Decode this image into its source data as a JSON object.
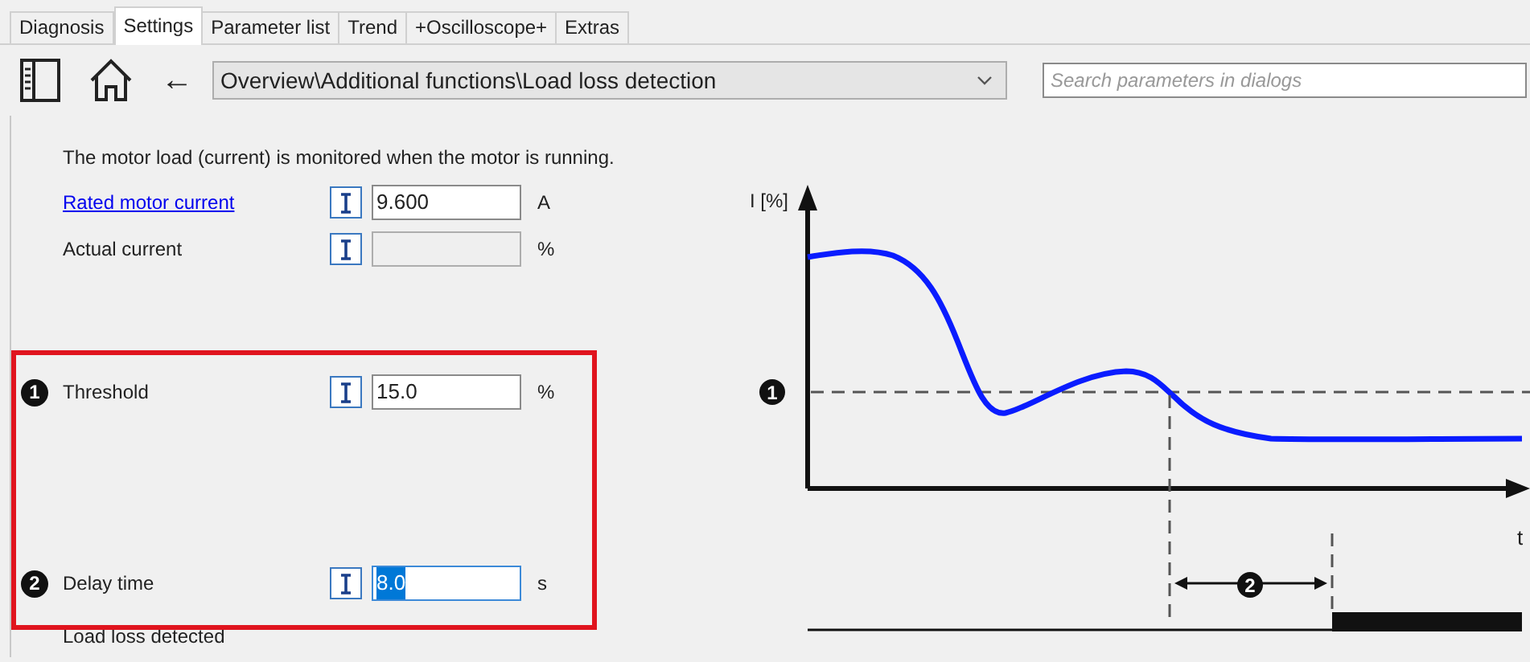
{
  "tabs": [
    {
      "label": "Diagnosis",
      "selected": false
    },
    {
      "label": "Settings",
      "selected": true
    },
    {
      "label": "Parameter list",
      "selected": false
    },
    {
      "label": "Trend",
      "selected": false
    },
    {
      "label": "+Oscilloscope+",
      "selected": false
    },
    {
      "label": "Extras",
      "selected": false
    }
  ],
  "toolbar": {
    "back_glyph": "←",
    "breadcrumb": "Overview\\Additional functions\\Load loss detection",
    "search": {
      "placeholder": "Search parameters in dialogs"
    }
  },
  "description": "The motor load (current) is monitored when the motor is running.",
  "parameters": [
    {
      "label": "Rated motor current",
      "link": true,
      "value": "9.600",
      "unit": "A",
      "disabled": false,
      "text_selected": false
    },
    {
      "label": "Actual current",
      "link": false,
      "unit": "%",
      "disabled": true,
      "text_selected": false
    },
    {
      "marker": "1",
      "label": "Threshold",
      "link": false,
      "value": "15.0",
      "unit": "%",
      "disabled": false,
      "text_selected": false
    },
    {
      "marker": "2",
      "label": "Delay time",
      "link": false,
      "value": "8.0",
      "unit": "s",
      "disabled": false,
      "text_selected": true
    }
  ],
  "status_label": "Load loss detected",
  "diagram": {
    "y_axis_label": "I [%]",
    "x_axis_label": "t",
    "threshold_marker": "1",
    "delay_marker": "2"
  }
}
